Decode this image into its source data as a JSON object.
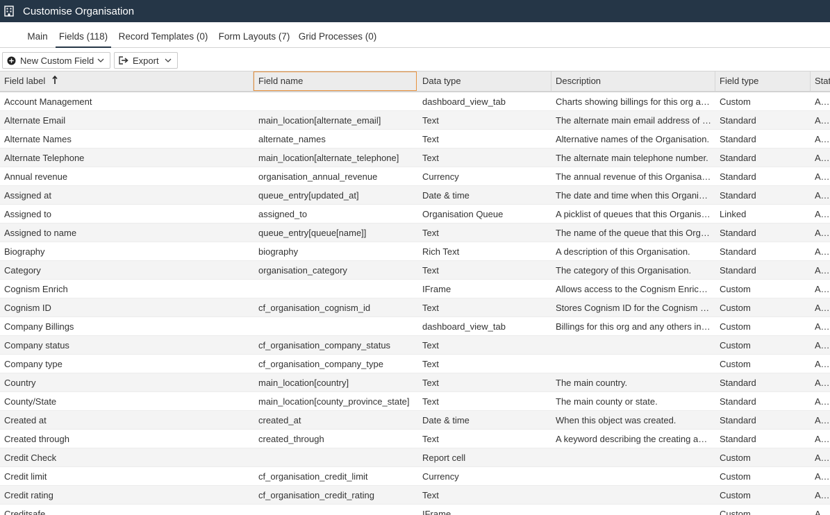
{
  "window": {
    "title": "Customise Organisation",
    "icon": "building-icon"
  },
  "tabs": [
    {
      "label": "Main",
      "active": false
    },
    {
      "label": "Fields (118)",
      "active": true
    },
    {
      "label": "Record Templates (0)",
      "active": false
    },
    {
      "label": "Form Layouts (7)",
      "active": false
    },
    {
      "label": "Grid Processes (0)",
      "active": false
    }
  ],
  "toolbar": {
    "new_field_label": "New Custom Field",
    "new_field_icon": "plus-circle-icon",
    "export_label": "Export",
    "export_icon": "export-icon"
  },
  "table": {
    "columns": [
      "Field label",
      "Field name",
      "Data type",
      "Description",
      "Field type",
      "Status"
    ],
    "sort_column": "Field label",
    "sort_direction": "ascending",
    "selected_header": "Field name",
    "rows": [
      [
        "Account Management",
        "",
        "dashboard_view_tab",
        "Charts showing billings for this org and others",
        "Custom",
        "Available"
      ],
      [
        "Alternate Email",
        "main_location[alternate_email]",
        "Text",
        "The alternate main email address of this Organisation.",
        "Standard",
        "Available"
      ],
      [
        "Alternate Names",
        "alternate_names",
        "Text",
        "Alternative names of the Organisation.",
        "Standard",
        "Available"
      ],
      [
        "Alternate Telephone",
        "main_location[alternate_telephone]",
        "Text",
        "The alternate main telephone number.",
        "Standard",
        "Available"
      ],
      [
        "Annual revenue",
        "organisation_annual_revenue",
        "Currency",
        "The annual revenue of this Organisation.",
        "Standard",
        "Available"
      ],
      [
        "Assigned at",
        "queue_entry[updated_at]",
        "Date & time",
        "The date and time when this Organisation was assigned.",
        "Standard",
        "Available"
      ],
      [
        "Assigned to",
        "assigned_to",
        "Organisation Queue",
        "A picklist of queues that this Organisation can be assigned to.",
        "Linked",
        "Available"
      ],
      [
        "Assigned to name",
        "queue_entry[queue[name]]",
        "Text",
        "The name of the queue that this Organisation is assigned to.",
        "Standard",
        "Available"
      ],
      [
        "Biography",
        "biography",
        "Rich Text",
        "A description of this Organisation.",
        "Standard",
        "Available"
      ],
      [
        "Category",
        "organisation_category",
        "Text",
        "The category of this Organisation.",
        "Standard",
        "Available"
      ],
      [
        "Cognism Enrich",
        "",
        "IFrame",
        "Allows access to the Cognism Enrich integration.",
        "Custom",
        "Available"
      ],
      [
        "Cognism ID",
        "cf_organisation_cognism_id",
        "Text",
        "Stores Cognism ID for the Cognism Enrich integration.",
        "Custom",
        "Available"
      ],
      [
        "Company Billings",
        "",
        "dashboard_view_tab",
        "Billings for this org and any others in the group.",
        "Custom",
        "Available"
      ],
      [
        "Company status",
        "cf_organisation_company_status",
        "Text",
        "",
        "Custom",
        "Available"
      ],
      [
        "Company type",
        "cf_organisation_company_type",
        "Text",
        "",
        "Custom",
        "Available"
      ],
      [
        "Country",
        "main_location[country]",
        "Text",
        "The main country.",
        "Standard",
        "Available"
      ],
      [
        "County/State",
        "main_location[county_province_state]",
        "Text",
        "The main county or state.",
        "Standard",
        "Available"
      ],
      [
        "Created at",
        "created_at",
        "Date & time",
        "When this object was created.",
        "Standard",
        "Available"
      ],
      [
        "Created through",
        "created_through",
        "Text",
        "A keyword describing the creating application.",
        "Standard",
        "Available"
      ],
      [
        "Credit Check",
        "",
        "Report cell",
        "",
        "Custom",
        "Available"
      ],
      [
        "Credit limit",
        "cf_organisation_credit_limit",
        "Currency",
        "",
        "Custom",
        "Available"
      ],
      [
        "Credit rating",
        "cf_organisation_credit_rating",
        "Text",
        "",
        "Custom",
        "Available"
      ],
      [
        "Creditsafe",
        "",
        "IFrame",
        "",
        "Custom",
        "Available"
      ]
    ]
  }
}
